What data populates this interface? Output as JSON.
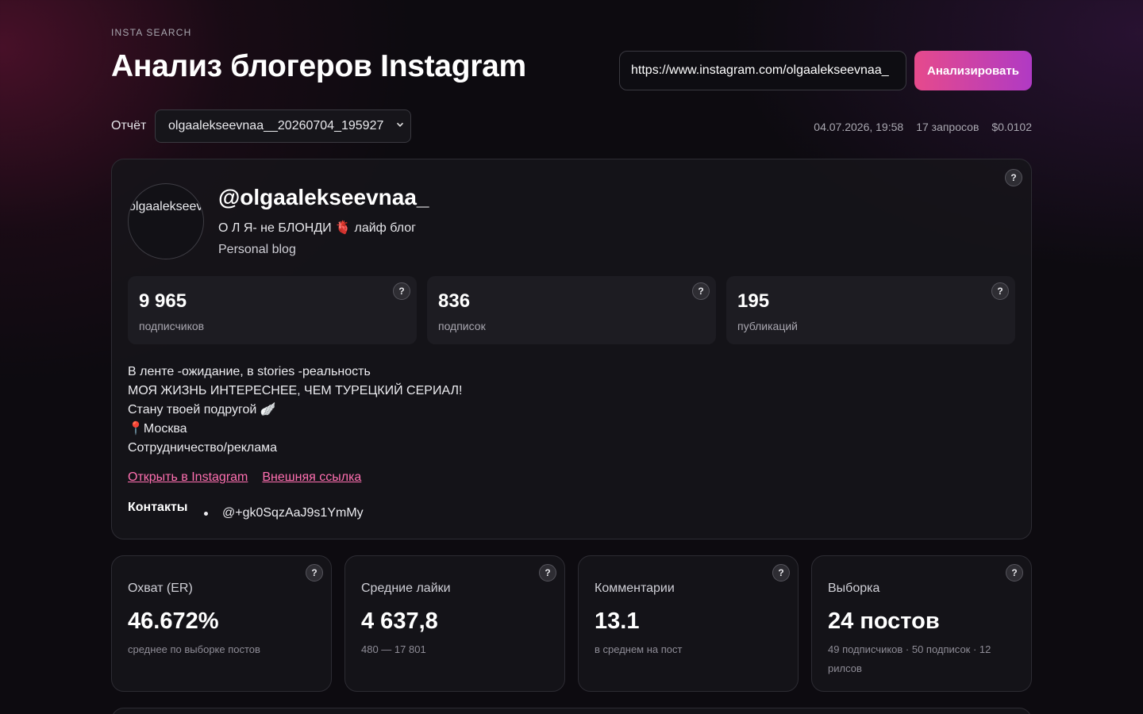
{
  "header": {
    "eyebrow": "INSTA SEARCH",
    "title": "Анализ блогеров Instagram",
    "url_value": "https://www.instagram.com/olgaalekseevnaa_",
    "analyze_label": "Анализировать"
  },
  "report": {
    "label": "Отчёт",
    "selected": "olgaalekseevnaa__20260704_195927",
    "date": "04.07.2026, 19:58",
    "requests": "17 запросов",
    "cost": "$0.0102"
  },
  "profile": {
    "avatar_text": "olgaalekseevnaa_",
    "handle": "@olgaalekseevnaa_",
    "full_name": "О Л Я- не БЛОНДИ 🫀 лайф блог",
    "category": "Personal blog",
    "help": "?",
    "stats": [
      {
        "value": "9 965",
        "label": "подписчиков"
      },
      {
        "value": "836",
        "label": "подписок"
      },
      {
        "value": "195",
        "label": "публикаций"
      }
    ],
    "bio": [
      "В ленте -ожидание, в stories -реальность",
      "МОЯ ЖИЗНЬ ИНТЕРЕСНЕЕ, ЧЕМ ТУРЕЦКИЙ СЕРИАЛ!",
      "Стану твоей подругой 🪽",
      "📍Москва",
      "Сотрудничество/реклама"
    ],
    "links": {
      "instagram": "Открыть в Instagram",
      "external": "Внешняя ссылка"
    },
    "contacts_label": "Контакты",
    "contacts": [
      "@+gk0SqzAaJ9s1YmMy"
    ]
  },
  "metrics": [
    {
      "label": "Охват (ER)",
      "value": "46.672%",
      "note": "среднее по выборке постов"
    },
    {
      "label": "Средние лайки",
      "value": "4 637,8",
      "note": "480 — 17 801"
    },
    {
      "label": "Комментарии",
      "value": "13.1",
      "note": "в среднем на пост"
    },
    {
      "label": "Выборка",
      "value": "24 постов",
      "note": "49 подписчиков · 50 подписок · 12 рилсов"
    }
  ],
  "colors": {
    "accent_start": "#e64a8c",
    "accent_end": "#b03ac4",
    "link": "#ff6fb0",
    "background": "#0d0b10"
  }
}
